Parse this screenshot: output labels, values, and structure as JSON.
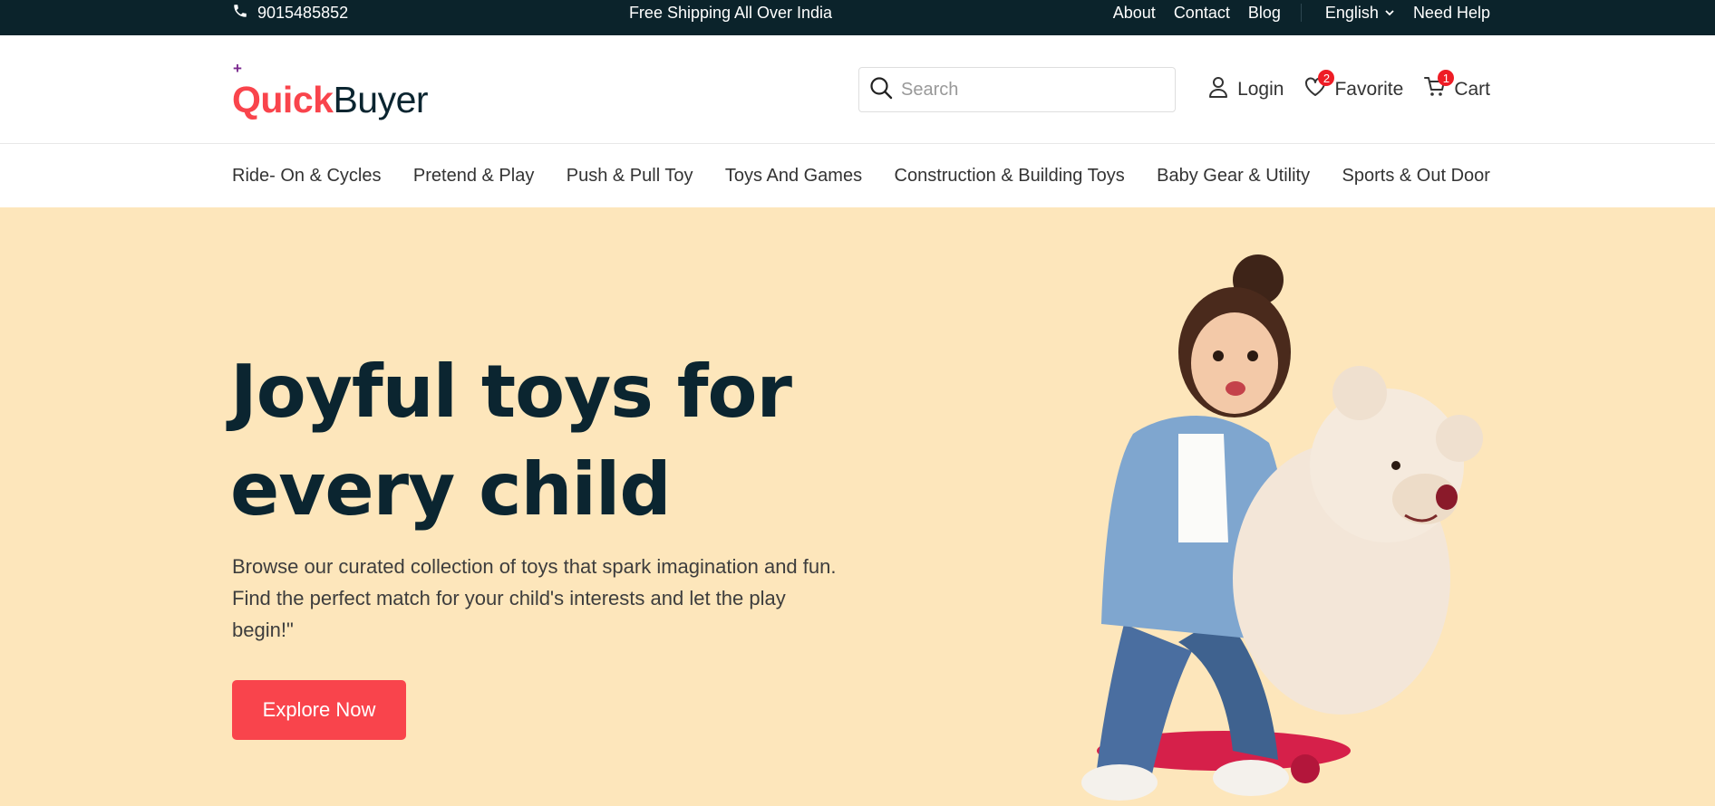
{
  "topbar": {
    "phone": "9015485852",
    "shipping": "Free Shipping All Over India",
    "links": [
      "About",
      "Contact",
      "Blog"
    ],
    "language": "English",
    "help": "Need Help"
  },
  "header": {
    "logo_plus": "+",
    "logo_quick": "Quick",
    "logo_buyer": "Buyer",
    "search_placeholder": "Search",
    "login_label": "Login",
    "favorite_label": "Favorite",
    "favorite_count": "2",
    "cart_label": "Cart",
    "cart_count": "1"
  },
  "categories": [
    "Ride- On & Cycles",
    "Pretend & Play",
    "Push & Pull Toy",
    "Toys And Games",
    "Construction & Building Toys",
    "Baby Gear & Utility",
    "Sports & Out Door"
  ],
  "hero": {
    "title_line1": "Joyful toys for",
    "title_line2": "every child",
    "description": "Browse our curated collection of toys that spark imagination and fun. Find the perfect match for your child's interests and let the play begin!\"",
    "cta_label": "Explore Now"
  },
  "colors": {
    "topbar_bg": "#0b232b",
    "brand_red": "#f9444c",
    "brand_dark": "#0b2530",
    "hero_bg": "#fde6bb",
    "badge_red": "#ee1c25"
  },
  "icons": {
    "phone": "phone-icon",
    "language_dropdown": "chevron-down-icon",
    "search": "search-icon",
    "login": "user-icon",
    "favorite": "heart-icon",
    "cart": "cart-icon"
  }
}
